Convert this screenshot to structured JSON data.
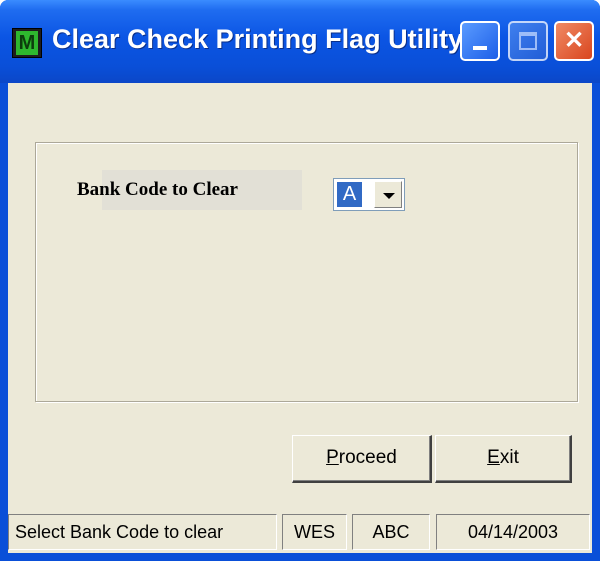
{
  "window": {
    "title": "Clear Check Printing Flag Utility",
    "app_icon_letter": "M"
  },
  "form": {
    "bank_code_label": "Bank Code to Clear",
    "bank_code_value": "A"
  },
  "buttons": {
    "proceed_label": "Proceed",
    "proceed_accel": "P",
    "proceed_rest": "roceed",
    "exit_accel": "E",
    "exit_rest": "xit"
  },
  "statusbar": {
    "message": "Select Bank Code to clear",
    "user": "WES",
    "company": "ABC",
    "date": "04/14/2003"
  },
  "colors": {
    "titlebar": "#0a4fd8",
    "client": "#ece9d8",
    "selection": "#316ac5"
  },
  "icons": {
    "app": "app-m-icon",
    "minimize": "minimize-icon",
    "maximize": "maximize-icon",
    "close": "close-icon",
    "dropdown": "chevron-down-icon"
  }
}
